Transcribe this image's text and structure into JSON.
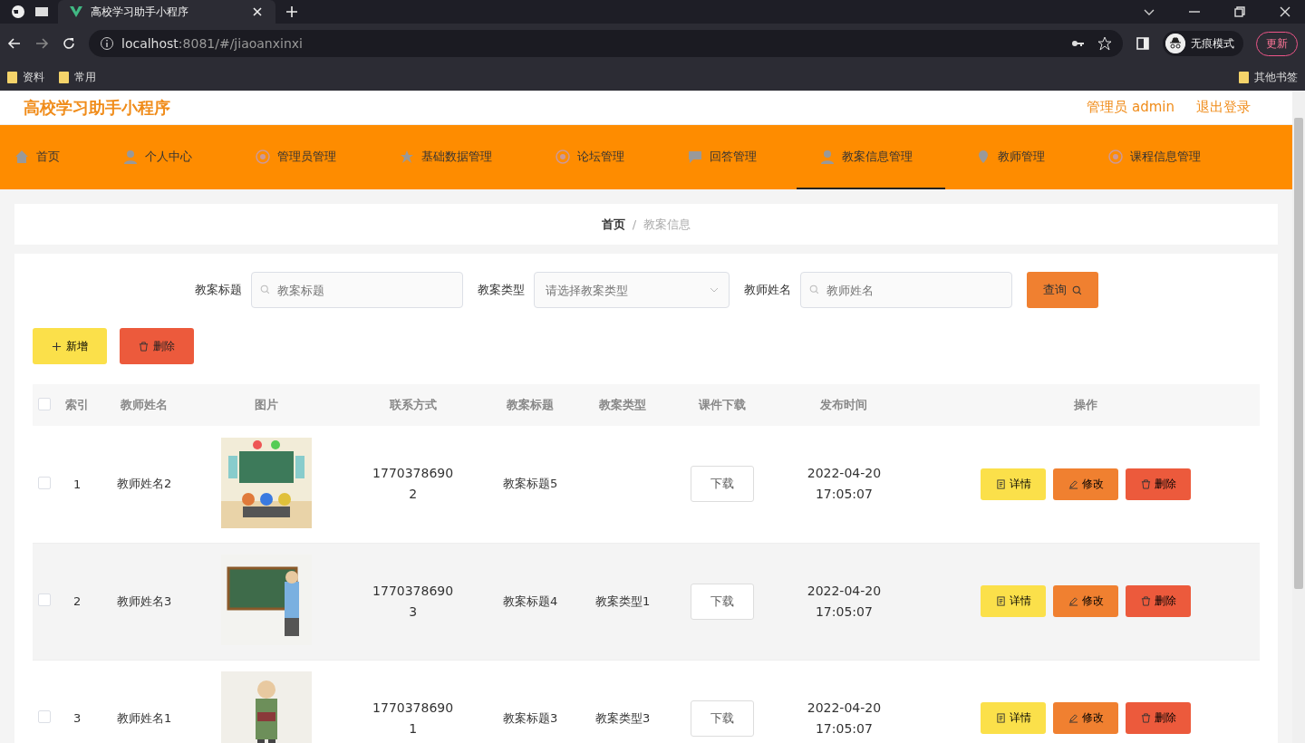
{
  "browser": {
    "tab_title": "高校学习助手小程序",
    "url_host": "localhost",
    "url_rest": ":8081/#/jiaoanxinxi",
    "profile": "无痕模式",
    "update": "更新",
    "bookmarks": [
      "资料",
      "常用"
    ],
    "other_bookmarks": "其他书签"
  },
  "header": {
    "title": "高校学习助手小程序",
    "user": "管理员 admin",
    "logout": "退出登录"
  },
  "nav": [
    {
      "label": "首页",
      "selected": false,
      "kind": "home"
    },
    {
      "label": "个人中心",
      "selected": false,
      "kind": "user"
    },
    {
      "label": "管理员管理",
      "selected": false,
      "kind": "circle"
    },
    {
      "label": "基础数据管理",
      "selected": false,
      "kind": "star"
    },
    {
      "label": "论坛管理",
      "selected": false,
      "kind": "circle"
    },
    {
      "label": "回答管理",
      "selected": false,
      "kind": "chat"
    },
    {
      "label": "教案信息管理",
      "selected": true,
      "kind": "user"
    },
    {
      "label": "教师管理",
      "selected": false,
      "kind": "pin"
    },
    {
      "label": "课程信息管理",
      "selected": false,
      "kind": "circle"
    }
  ],
  "breadcrumb": {
    "items": [
      "首页",
      "教案信息"
    ],
    "separator": "/"
  },
  "search": [
    {
      "label": "教案标题",
      "kind": "input",
      "placeholder": "教案标题"
    },
    {
      "label": "教案类型",
      "kind": "select",
      "placeholder": "请选择教案类型"
    },
    {
      "label": "教师姓名",
      "kind": "input",
      "placeholder": "教师姓名"
    }
  ],
  "query_button": "查询",
  "actions": {
    "add": "新增",
    "delete": "删除"
  },
  "table": {
    "all_checked": false,
    "columns": [
      "索引",
      "教师姓名",
      "图片",
      "联系方式",
      "教案标题",
      "教案类型",
      "课件下载",
      "发布时间",
      "操作"
    ],
    "rows": [
      {
        "checked": false,
        "index": "1",
        "teacher": "教师姓名2",
        "phone": "17703786902",
        "title": "教案标题5",
        "download": "下载",
        "time": "2022-04-20 17:05:07",
        "buttons": [
          "详情",
          "修改",
          "删除"
        ]
      },
      {
        "checked": false,
        "index": "2",
        "teacher": "教师姓名3",
        "phone": "17703786903",
        "title": "教案标题4",
        "type": "教案类型1",
        "download": "下载",
        "time": "2022-04-20 17:05:07",
        "buttons": [
          "详情",
          "修改",
          "删除"
        ]
      },
      {
        "checked": false,
        "index": "3",
        "teacher": "教师姓名1",
        "phone": "17703786901",
        "title": "教案标题3",
        "type": "教案类型3",
        "download": "下载",
        "time": "2022-04-20 17:05:07",
        "buttons": [
          "详情",
          "修改",
          "删除"
        ]
      }
    ]
  }
}
